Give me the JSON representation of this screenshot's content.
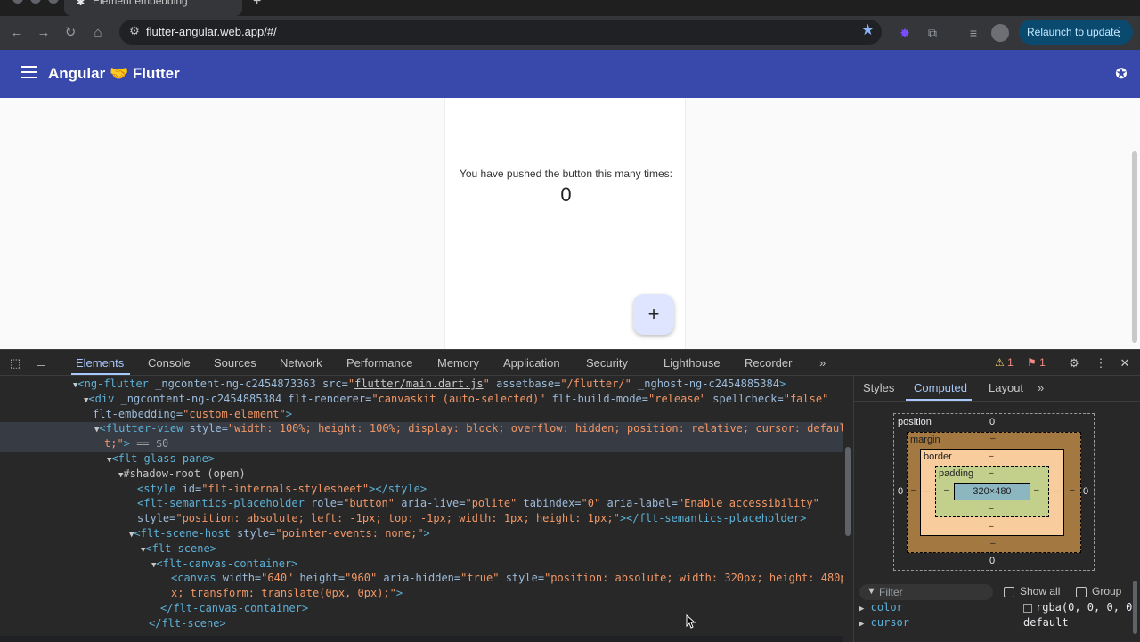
{
  "browser": {
    "tab_title": "Element embedding",
    "url": "flutter-angular.web.app/#/",
    "relaunch_label": "Relaunch to update"
  },
  "app": {
    "title": "Angular 🤝 Flutter",
    "counter_label": "You have pushed the button this many times:",
    "counter_value": "0",
    "fab_label": "+"
  },
  "devtools": {
    "tabs": [
      "Elements",
      "Console",
      "Sources",
      "Network",
      "Performance",
      "Memory",
      "Application",
      "Security",
      "Lighthouse",
      "Recorder"
    ],
    "more_tabs": "»",
    "warning_count": "1",
    "error_count": "1",
    "sidebar_tabs": [
      "Styles",
      "Computed",
      "Layout"
    ],
    "selected_marker": "== $0",
    "dom_lines": [
      {
        "tokens": [
          "<ng-flutter",
          " _ngcontent-ng-c2454873363",
          " src=",
          "\"",
          "flutter/main.dart.js",
          "\"",
          " assetbase=",
          "\"/flutter/\"",
          " _nghost-ng-c2454885384",
          ">"
        ]
      },
      {
        "tokens": [
          "<div",
          " _ngcontent-ng-c2454885384",
          " flt-renderer=",
          "\"canvaskit (auto-selected)\"",
          " flt-build-mode=",
          "\"release\"",
          " spellcheck=",
          "\"false\""
        ]
      },
      {
        "tokens": [
          "flt-embedding=",
          "\"custom-element\"",
          ">"
        ]
      },
      {
        "tokens": [
          "<flutter-view",
          " style=",
          "\"width: 100%; height: 100%; display: block; overflow: hidden; position: relative; cursor: defaul"
        ]
      },
      {
        "tokens": [
          "t;\"",
          ">"
        ]
      },
      {
        "tokens": [
          "<flt-glass-pane",
          ">"
        ]
      },
      {
        "tokens": [
          "#shadow-root (open)"
        ]
      },
      {
        "tokens": [
          "<style",
          " id=",
          "\"flt-internals-stylesheet\"",
          "></style>"
        ]
      },
      {
        "tokens": [
          "<flt-semantics-placeholder",
          " role=",
          "\"button\"",
          " aria-live=",
          "\"polite\"",
          " tabindex=",
          "\"0\"",
          " aria-label=",
          "\"Enable accessibility\""
        ]
      },
      {
        "tokens": [
          "style=",
          "\"position: absolute; left: -1px; top: -1px; width: 1px; height: 1px;\"",
          "></flt-semantics-placeholder>"
        ]
      },
      {
        "tokens": [
          "<flt-scene-host",
          " style=",
          "\"pointer-events: none;\"",
          ">"
        ]
      },
      {
        "tokens": [
          "<flt-scene",
          ">"
        ]
      },
      {
        "tokens": [
          "<flt-canvas-container",
          ">"
        ]
      },
      {
        "tokens": [
          "<canvas",
          " width=",
          "\"640\"",
          " height=",
          "\"960\"",
          " aria-hidden=",
          "\"true\"",
          " style=",
          "\"position: absolute; width: 320px; height: 480p"
        ]
      },
      {
        "tokens": [
          "x; transform: translate(0px, 0px);\"",
          ">"
        ]
      },
      {
        "tokens": [
          "</flt-canvas-container>"
        ]
      },
      {
        "tokens": [
          "</flt-scene>"
        ]
      }
    ],
    "box_model": {
      "position_label": "position",
      "position_top": "0",
      "position_bottom": "0",
      "position_left": "0",
      "position_right": "0",
      "margin_label": "margin",
      "border_label": "border",
      "padding_label": "padding",
      "content_size": "320×480",
      "dash": "–"
    },
    "filter_placeholder": "Filter",
    "show_all_label": "Show all",
    "group_label": "Group",
    "computed_props": [
      {
        "name": "color",
        "value": "rgba(0, 0, 0, 0."
      },
      {
        "name": "cursor",
        "value": "default"
      }
    ]
  }
}
